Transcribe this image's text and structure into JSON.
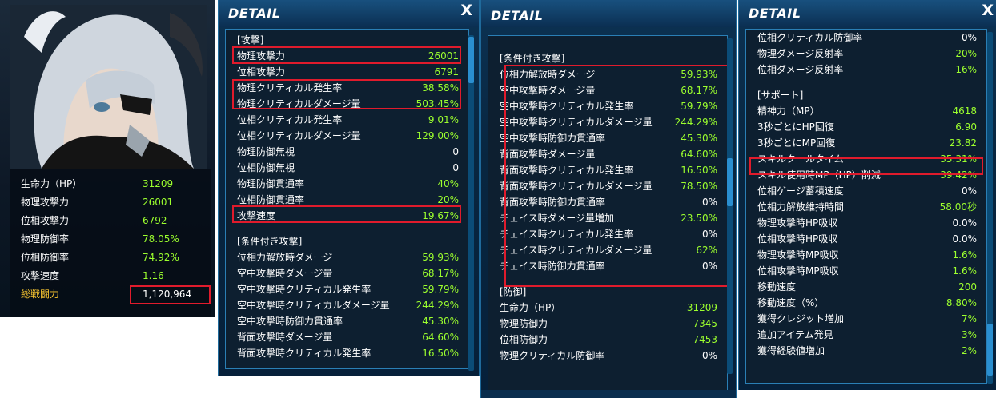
{
  "character": {
    "stats": [
      {
        "label": "生命力（HP）",
        "value": "31209"
      },
      {
        "label": "物理攻撃力",
        "value": "26001"
      },
      {
        "label": "位相攻撃力",
        "value": "6792"
      },
      {
        "label": "物理防御率",
        "value": "78.05%"
      },
      {
        "label": "位相防御率",
        "value": "74.92%"
      },
      {
        "label": "攻撃速度",
        "value": "1.16"
      },
      {
        "label": "総戦闘力",
        "value": "1,120,964"
      }
    ]
  },
  "panel1": {
    "title": "DETAIL",
    "close": "X",
    "rows": [
      {
        "label": "[攻撃]",
        "value": "",
        "section": true
      },
      {
        "label": "物理攻撃力",
        "value": "26001"
      },
      {
        "label": "位相攻撃力",
        "value": "6791"
      },
      {
        "label": "物理クリティカル発生率",
        "value": "38.58%"
      },
      {
        "label": "物理クリティカルダメージ量",
        "value": "503.45%"
      },
      {
        "label": "位相クリティカル発生率",
        "value": "9.01%"
      },
      {
        "label": "位相クリティカルダメージ量",
        "value": "129.00%"
      },
      {
        "label": "物理防御無視",
        "value": "0"
      },
      {
        "label": "位相防御無視",
        "value": "0"
      },
      {
        "label": "物理防御貫通率",
        "value": "40%"
      },
      {
        "label": "位相防御貫通率",
        "value": "20%"
      },
      {
        "label": "攻撃速度",
        "value": "19.67%"
      },
      {
        "label": "",
        "value": "",
        "spacer": true
      },
      {
        "label": "[条件付き攻撃]",
        "value": "",
        "section": true
      },
      {
        "label": "位相力解放時ダメージ",
        "value": "59.93%"
      },
      {
        "label": "空中攻撃時ダメージ量",
        "value": "68.17%"
      },
      {
        "label": "空中攻撃時クリティカル発生率",
        "value": "59.79%"
      },
      {
        "label": "空中攻撃時クリティカルダメージ量",
        "value": "244.29%"
      },
      {
        "label": "空中攻撃時防御力貫通率",
        "value": "45.30%"
      },
      {
        "label": "背面攻撃時ダメージ量",
        "value": "64.60%"
      },
      {
        "label": "背面攻撃時クリティカル発生率",
        "value": "16.50%"
      }
    ]
  },
  "panel2": {
    "title": "DETAIL",
    "rows": [
      {
        "label": "[条件付き攻撃]",
        "value": "",
        "section": true
      },
      {
        "label": "位相力解放時ダメージ",
        "value": "59.93%"
      },
      {
        "label": "空中攻撃時ダメージ量",
        "value": "68.17%"
      },
      {
        "label": "空中攻撃時クリティカル発生率",
        "value": "59.79%"
      },
      {
        "label": "空中攻撃時クリティカルダメージ量",
        "value": "244.29%"
      },
      {
        "label": "空中攻撃時防御力貫通率",
        "value": "45.30%"
      },
      {
        "label": "背面攻撃時ダメージ量",
        "value": "64.60%"
      },
      {
        "label": "背面攻撃時クリティカル発生率",
        "value": "16.50%"
      },
      {
        "label": "背面攻撃時クリティカルダメージ量",
        "value": "78.50%"
      },
      {
        "label": "背面攻撃時防御力貫通率",
        "value": "0%"
      },
      {
        "label": "チェイス時ダメージ量増加",
        "value": "23.50%"
      },
      {
        "label": "チェイス時クリティカル発生率",
        "value": "0%"
      },
      {
        "label": "チェイス時クリティカルダメージ量",
        "value": "62%"
      },
      {
        "label": "チェイス時防御力貫通率",
        "value": "0%"
      },
      {
        "label": "",
        "value": "",
        "spacer": true
      },
      {
        "label": "[防御]",
        "value": "",
        "section": true
      },
      {
        "label": "生命力（HP）",
        "value": "31209"
      },
      {
        "label": "物理防御力",
        "value": "7345"
      },
      {
        "label": "位相防御力",
        "value": "7453"
      },
      {
        "label": "物理クリティカル防御率",
        "value": "0%"
      }
    ]
  },
  "panel3": {
    "title": "DETAIL",
    "close": "X",
    "rows": [
      {
        "label": "位相クリティカル防御率",
        "value": "0%"
      },
      {
        "label": "物理ダメージ反射率",
        "value": "20%"
      },
      {
        "label": "位相ダメージ反射率",
        "value": "16%"
      },
      {
        "label": "",
        "value": "",
        "spacer": true
      },
      {
        "label": "[サポート]",
        "value": "",
        "section": true
      },
      {
        "label": "精神力（MP）",
        "value": "4618"
      },
      {
        "label": "3秒ごとにHP回復",
        "value": "6.90"
      },
      {
        "label": "3秒ごとにMP回復",
        "value": "23.82"
      },
      {
        "label": "スキルクールタイム",
        "value": "35.31%"
      },
      {
        "label": "スキル使用時MP（HP）削減",
        "value": "39.42%"
      },
      {
        "label": "位相ゲージ蓄積速度",
        "value": "0%"
      },
      {
        "label": "位相力解放維持時間",
        "value": "58.00秒"
      },
      {
        "label": "物理攻撃時HP吸収",
        "value": "0.0%"
      },
      {
        "label": "位相攻撃時HP吸収",
        "value": "0.0%"
      },
      {
        "label": "物理攻撃時MP吸収",
        "value": "1.6%"
      },
      {
        "label": "位相攻撃時MP吸収",
        "value": "1.6%"
      },
      {
        "label": "移動速度",
        "value": "200"
      },
      {
        "label": "移動速度（%）",
        "value": "8.80%"
      },
      {
        "label": "獲得クレジット増加",
        "value": "7%"
      },
      {
        "label": "追加アイテム発見",
        "value": "3%"
      },
      {
        "label": "獲得経験値増加",
        "value": "2%"
      }
    ]
  },
  "colors": {
    "panel_bg": "#082640",
    "value_green": "#9cff2e",
    "section_gold": "#f7c430",
    "highlight_red": "#e01b2c"
  }
}
